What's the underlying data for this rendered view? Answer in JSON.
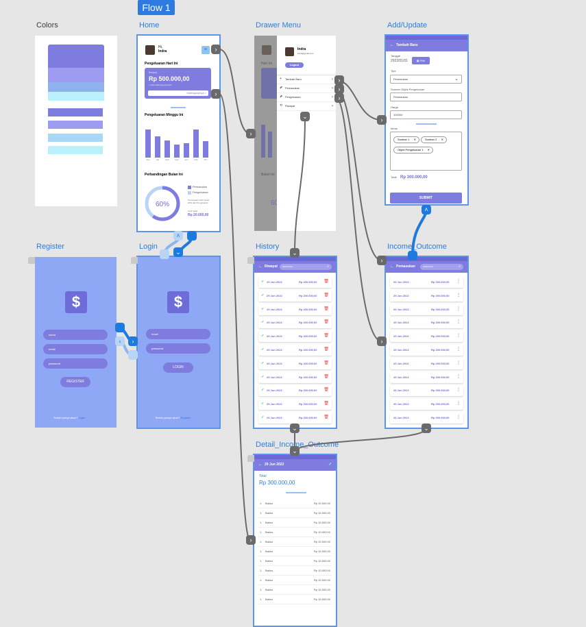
{
  "flow_tag": "Flow 1",
  "frames": {
    "colors": "Colors",
    "home": "Home",
    "drawer": "Drawer Menu",
    "add": "Add/Update",
    "register": "Register",
    "login": "Login",
    "history": "History",
    "income": "Income_Outcome",
    "detail": "Detail_Income_Outcome"
  },
  "palette": [
    "#7f7ce0",
    "#9d9cf0",
    "#8fb2ee",
    "#a8d8f7",
    "#b9f0fb"
  ],
  "home": {
    "greeting": "Hi,",
    "user": "Indra",
    "today_title": "Pengeluaran Hari Ini",
    "card_caption": "Belanji",
    "amount": "Rp 500.000,00",
    "card_note": "+ 20% dibanding kemarin",
    "card_link": "Selengkapnya >",
    "week_title": "Pengeluaran Minggu Ini",
    "days": [
      "Sen",
      "Sel",
      "Rab",
      "Kam",
      "Jum",
      "Sab",
      "Min"
    ],
    "bars": [
      0.74,
      0.55,
      0.44,
      0.34,
      0.38,
      0.74,
      0.42
    ],
    "compare_title": "Perbandingan Bulan Ini",
    "percent": "60%",
    "percent_value": 0.6,
    "legend": [
      "Pemasukan",
      "Pengeluaran"
    ],
    "compare_note": "Pemasukan lebih besar 20% dari Pengeluaran",
    "total_caption": "Total saldo",
    "total": "Rp 20.000,00"
  },
  "drawer": {
    "name": "Indra",
    "email": "indra@gmail.com",
    "logout": "Logout",
    "items": [
      "Tambah Baru",
      "Pemasukan",
      "Pengeluaran",
      "Riwayat"
    ],
    "bg_greeting": "Hari Ini",
    "bg_bottom": "Bulan Ini",
    "bg_percent": "60"
  },
  "add": {
    "title": "Tambah Baru",
    "date_label": "Tanggal",
    "date_value": "2022/01/01",
    "pick": "Pilih",
    "type_label": "Tipe",
    "type_value": "Pemasukan",
    "source_label": "Sumber Objek Pengeluaran",
    "source_value": "Pemasukan",
    "price_label": "Harga",
    "price_value": "100000",
    "items_label": "Items",
    "chips": [
      "Sumber 1",
      "Sumber 2",
      "Objek Pengeluaran 1"
    ],
    "total_label": "Total:",
    "total_value": "Rp 300.000,00",
    "submit": "SUBMIT"
  },
  "register": {
    "fields": [
      "nama",
      "email",
      "password"
    ],
    "button": "REGISTER",
    "footer": "Sudah punya akun?",
    "footer_link": "Login"
  },
  "login": {
    "fields": [
      "email",
      "password"
    ],
    "button": "LOGIN",
    "footer": "Belum punya akun?",
    "footer_link": "Register"
  },
  "history": {
    "title": "Riwayat",
    "search": "2022/01/01",
    "row_date": "29 Jun 2022",
    "row_amount": "Rp 200.000,00",
    "rows": 11
  },
  "income": {
    "title": "Pemasukan",
    "search": "2022/01/01",
    "row_date": "29 Jun 2022",
    "row_amount": "Rp 200.000,00",
    "rows": 11
  },
  "detail": {
    "title": "29 Jun 2022",
    "total_label": "Total",
    "total": "Rp 300.000,00",
    "item_no": "1.",
    "item_name": "Bakso",
    "item_price": "Rp 10.000,00",
    "rows": 11
  }
}
